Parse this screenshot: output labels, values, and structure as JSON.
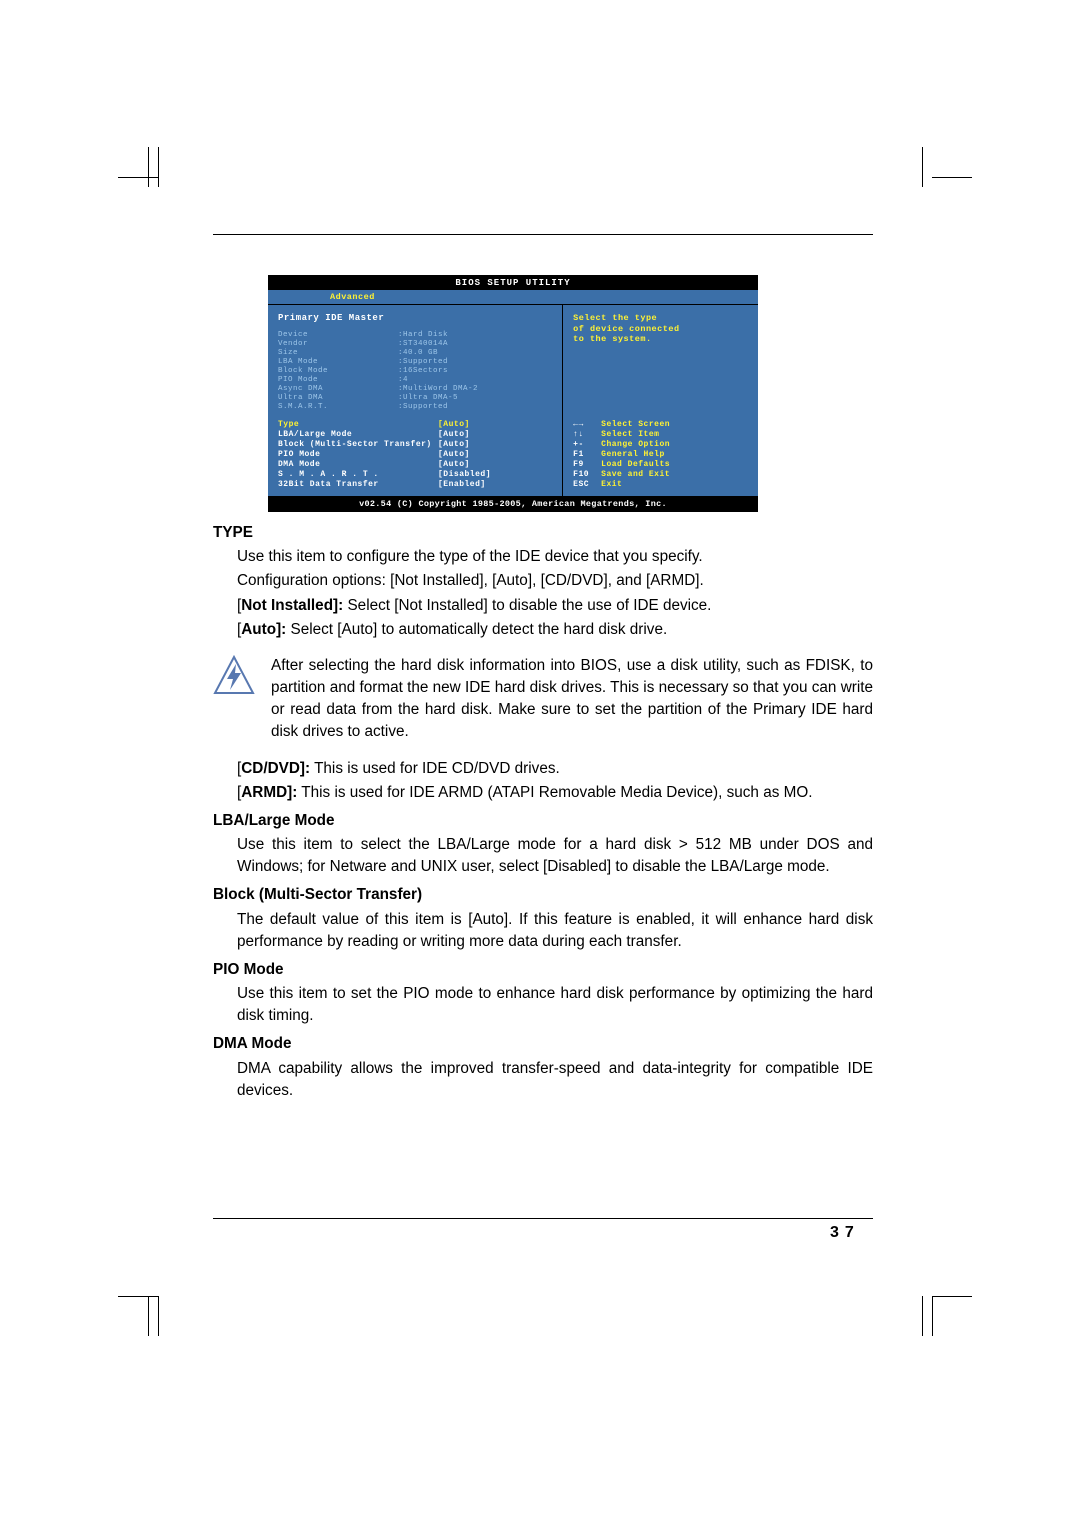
{
  "bios": {
    "title": "BIOS SETUP UTILITY",
    "active_tab": "Advanced",
    "section_title": "Primary IDE Master",
    "info": [
      {
        "k": "Device",
        "v": ":Hard Disk"
      },
      {
        "k": "Vendor",
        "v": ":ST340014A"
      },
      {
        "k": "Size",
        "v": ":40.0 GB"
      },
      {
        "k": "LBA Mode",
        "v": ":Supported"
      },
      {
        "k": "Block Mode",
        "v": ":16Sectors"
      },
      {
        "k": "PIO Mode",
        "v": ":4"
      },
      {
        "k": "Async DMA",
        "v": ":MultiWord DMA-2"
      },
      {
        "k": "Ultra DMA",
        "v": ":Ultra DMA-5"
      },
      {
        "k": "S.M.A.R.T.",
        "v": ":Supported"
      }
    ],
    "options": [
      {
        "k": "Type",
        "v": "[Auto]",
        "selected": true
      },
      {
        "k": "LBA/Large Mode",
        "v": "[Auto]"
      },
      {
        "k": "Block (Multi-Sector Transfer)",
        "v": "[Auto]"
      },
      {
        "k": "PIO Mode",
        "v": "[Auto]"
      },
      {
        "k": "DMA Mode",
        "v": "[Auto]"
      },
      {
        "k": "S . M . A . R . T .",
        "v": "[Disabled]"
      },
      {
        "k": "32Bit Data Transfer",
        "v": "[Enabled]"
      }
    ],
    "help": {
      "line1": "Select the type",
      "line2": "of device connected",
      "line3": "to the system."
    },
    "nav": [
      {
        "k": "←→",
        "v": "Select Screen"
      },
      {
        "k": "↑↓",
        "v": "Select Item"
      },
      {
        "k": "+-",
        "v": "Change Option"
      },
      {
        "k": "F1",
        "v": "General Help"
      },
      {
        "k": "F9",
        "v": "Load Defaults"
      },
      {
        "k": "F10",
        "v": "Save and Exit"
      },
      {
        "k": "ESC",
        "v": "Exit"
      }
    ],
    "footer": "v02.54 (C) Copyright 1985-2005, American Megatrends, Inc."
  },
  "sections": {
    "type": {
      "title": "TYPE",
      "p1": "Use this item to configure the type of the IDE device that you specify.",
      "p2": "Configuration options: [Not Installed], [Auto], [CD/DVD], and [ARMD].",
      "not_installed_label": "Not Installed]:",
      "not_installed_text": " Select [Not Installed] to disable the use of IDE device.",
      "auto_label": "Auto]:",
      "auto_text": " Select [Auto] to automatically detect the hard disk drive.",
      "note": "After selecting the hard disk information into BIOS, use a disk utility, such as FDISK, to partition and format the new IDE hard disk drives. This is necessary so that you can write or read data from the hard disk. Make sure to set the partition of the Primary IDE hard disk drives to active.",
      "cd_label": "CD/DVD]:",
      "cd_text": " This is used for IDE CD/DVD drives.",
      "armd_label": "ARMD]:",
      "armd_text": "  This is used for IDE ARMD (ATAPI Removable Media Device), such as MO."
    },
    "lba": {
      "title": "LBA/Large Mode",
      "p": "Use this item to select the LBA/Large mode for a hard disk > 512 MB under DOS and Windows; for Netware and UNIX user, select [Disabled] to disable the LBA/Large mode."
    },
    "block": {
      "title": "Block (Multi-Sector Transfer)",
      "p": "The default value of this item is [Auto]. If this feature is enabled, it will enhance hard disk performance by reading or writing more data during each transfer."
    },
    "pio": {
      "title": "PIO Mode",
      "p": "Use this item to set the PIO mode to enhance hard disk performance by optimizing the hard disk timing."
    },
    "dma": {
      "title": "DMA Mode",
      "p": "DMA capability allows the improved transfer-speed and data-integrity for compatible IDE devices."
    }
  },
  "page_number": "37"
}
